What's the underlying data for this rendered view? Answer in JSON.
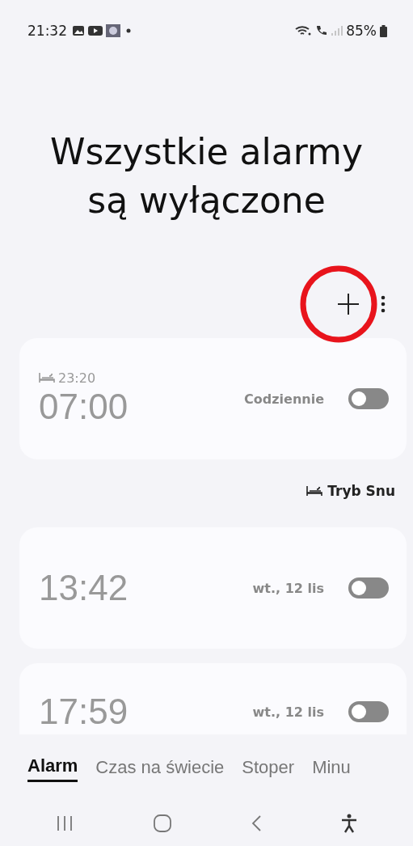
{
  "status_bar": {
    "time": "21:32",
    "battery": "85%"
  },
  "title": "Wszystkie alarmy są wyłączone",
  "alarms": [
    {
      "bedtime": "23:20",
      "time": "07:00",
      "repeat": "Codziennie",
      "on": false
    },
    {
      "time": "13:42",
      "repeat": "wt., 12 lis",
      "on": false
    },
    {
      "time": "17:59",
      "repeat": "wt., 12 lis",
      "on": false
    }
  ],
  "sleep_mode_label": "Tryb Snu",
  "tabs": [
    {
      "label": "Alarm",
      "selected": true
    },
    {
      "label": "Czas na świecie",
      "selected": false
    },
    {
      "label": "Stoper",
      "selected": false
    },
    {
      "label": "Minu",
      "selected": false
    }
  ]
}
